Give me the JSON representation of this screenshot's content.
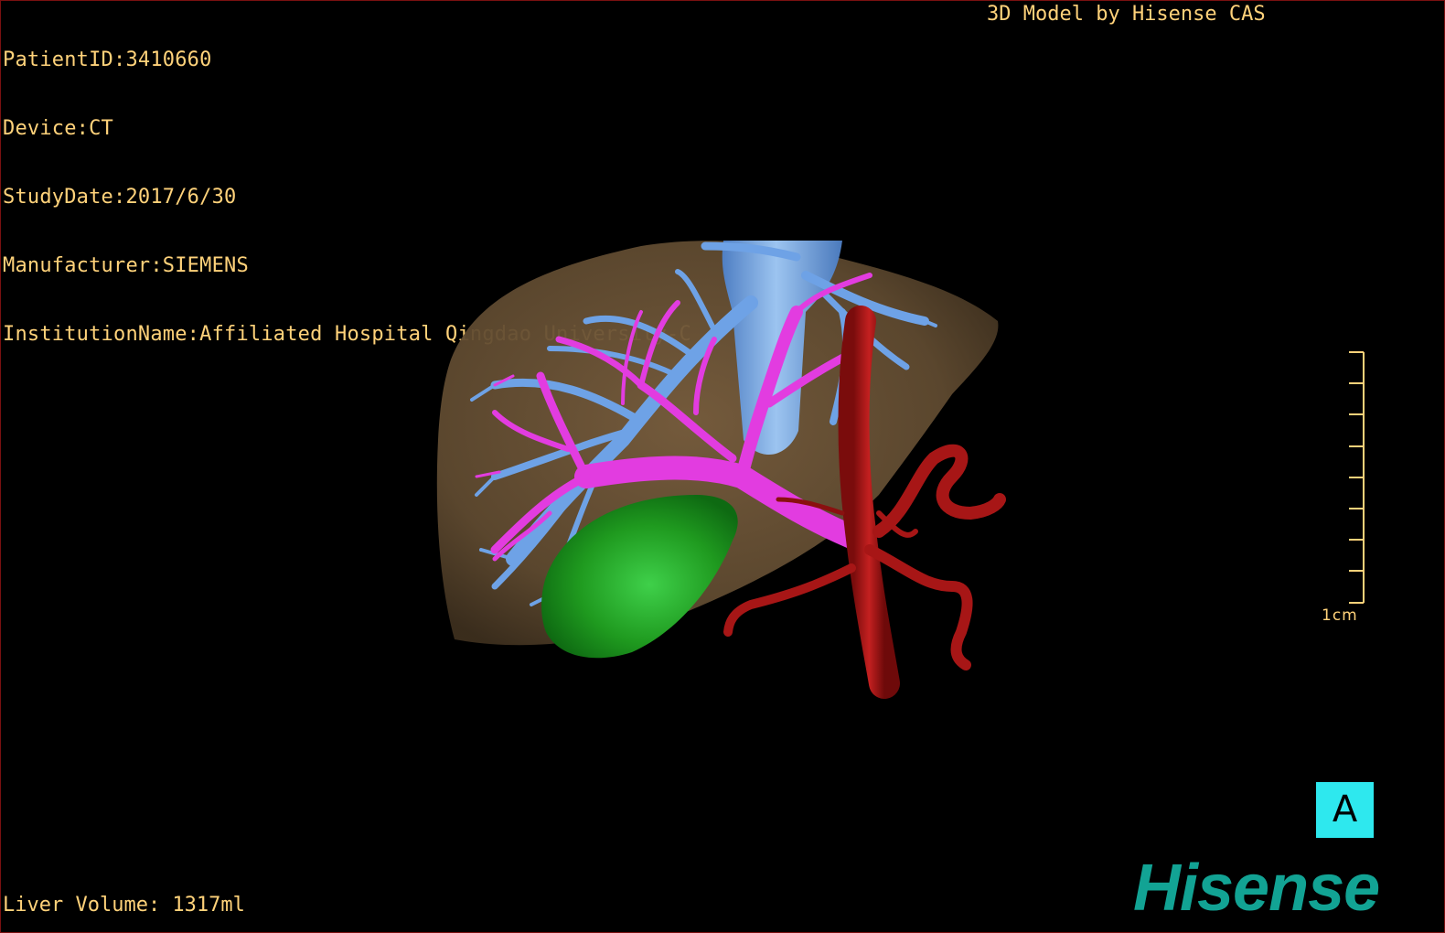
{
  "overlay": {
    "patient_id": "PatientID:3410660",
    "device": "Device:CT",
    "study_date": "StudyDate:2017/6/30",
    "manufacturer": "Manufacturer:SIEMENS",
    "institution": "InstitutionName:Affiliated Hospital Qingdao University-C",
    "credit": "3D Model by Hisense CAS",
    "liver_volume": "Liver Volume: 1317ml"
  },
  "scale_bar": {
    "label": "1cm"
  },
  "orientation_marker": {
    "label": "A"
  },
  "brand": {
    "name": "Hisense"
  },
  "colors": {
    "text": "#ffd27a",
    "liver": "#6b5236",
    "hepatic_veins": "#6ea2e6",
    "portal_vein": "#e23ce0",
    "gallbladder": "#1f9a1f",
    "artery": "#a71616",
    "orientation_box": "#2ee8ee",
    "brand": "#12a394"
  },
  "model_parts": [
    "liver",
    "hepatic-veins",
    "inferior-vena-cava",
    "portal-vein",
    "gallbladder",
    "hepatic-artery"
  ]
}
